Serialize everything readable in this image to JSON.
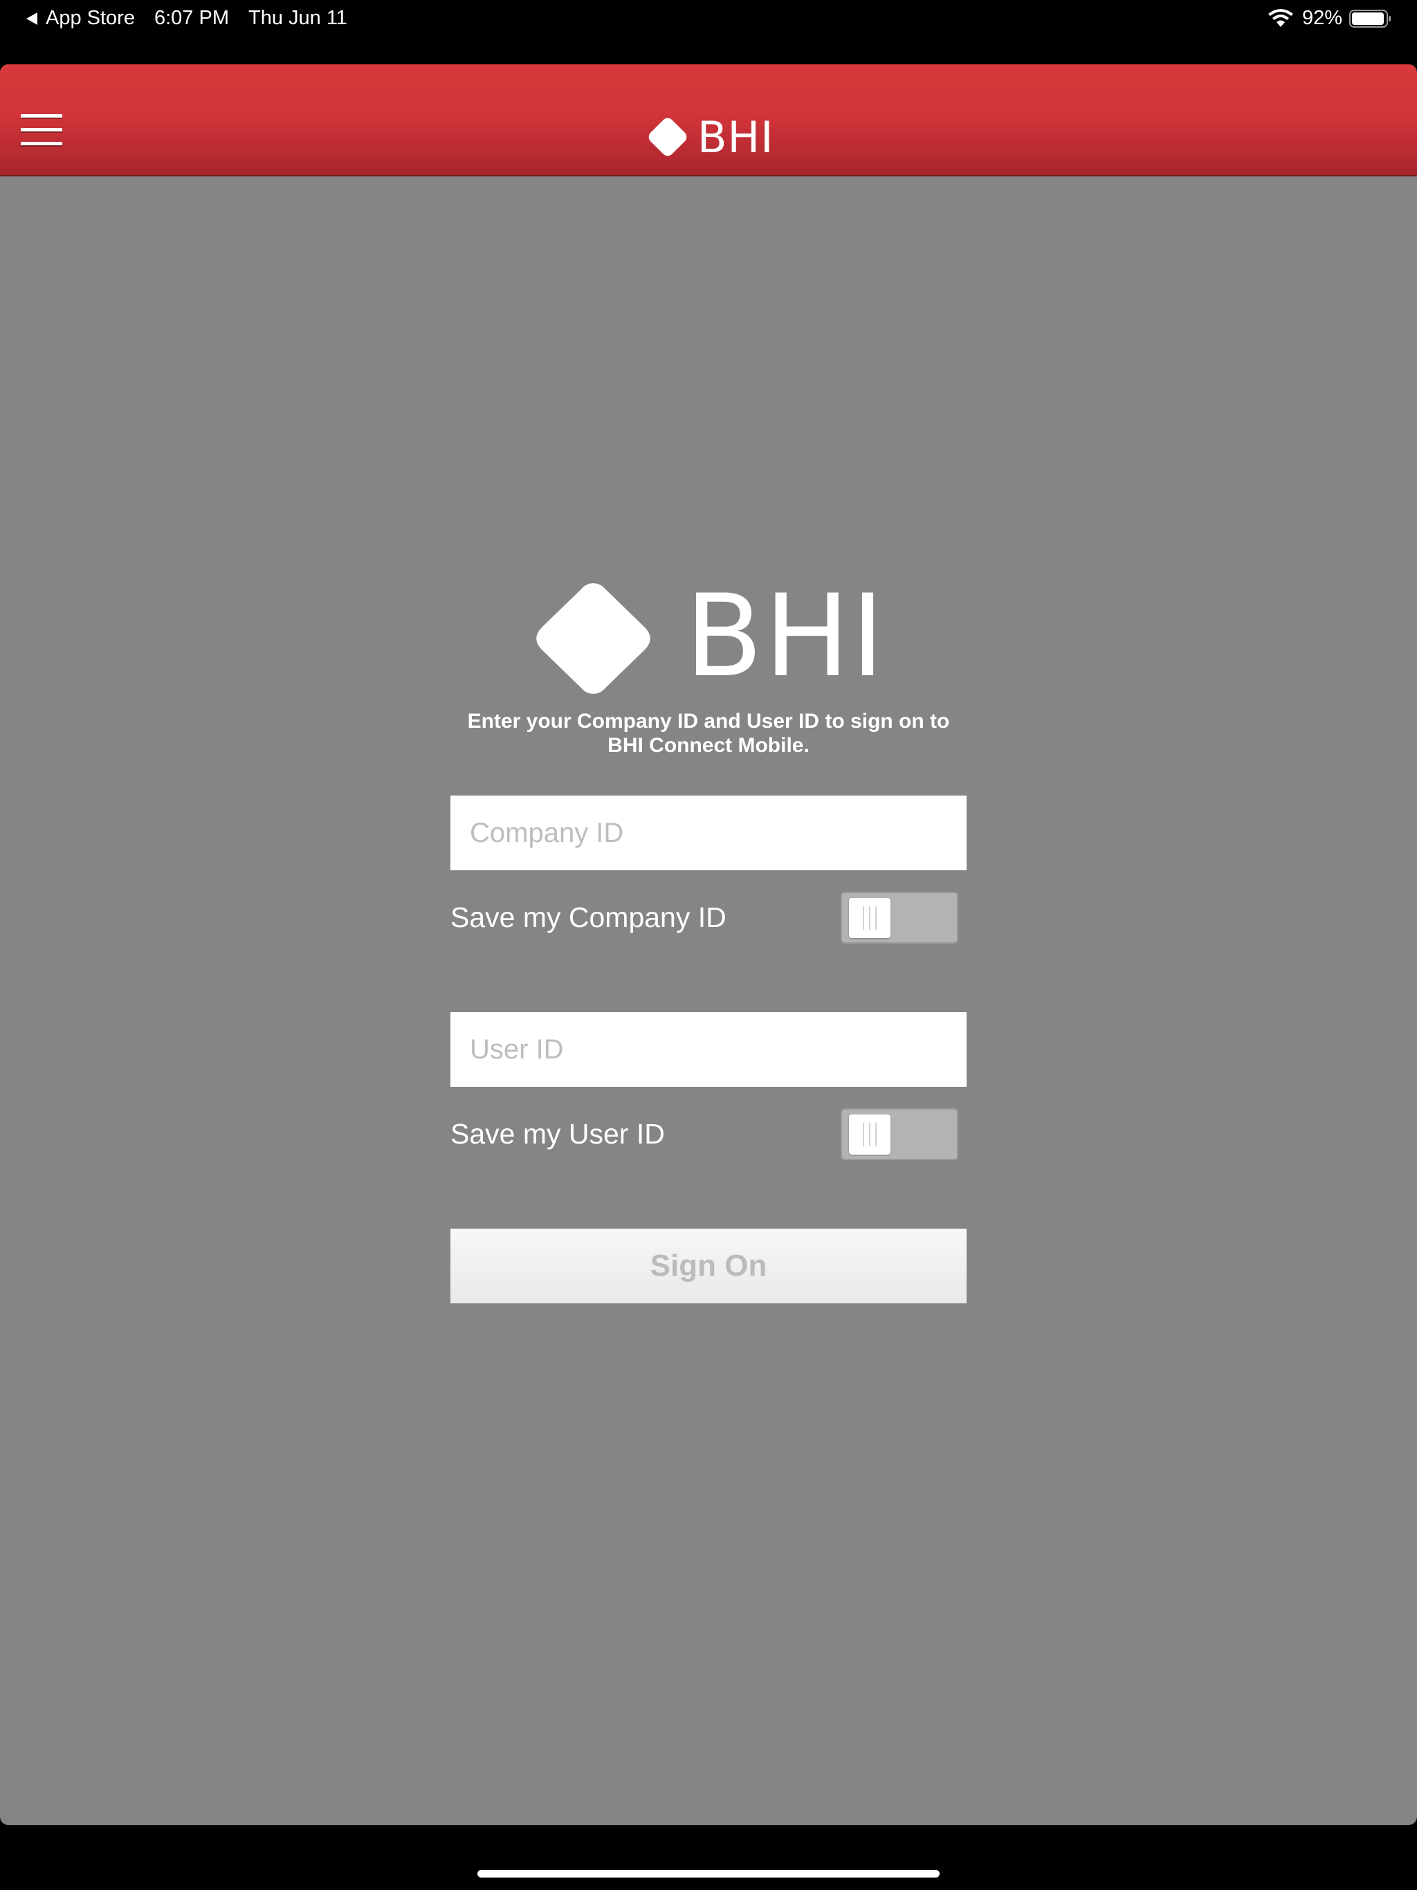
{
  "status_bar": {
    "back_app": "App Store",
    "time": "6:07 PM",
    "date": "Thu Jun 11",
    "battery": "92%",
    "icons": [
      "back-arrow-icon",
      "wifi-icon",
      "battery-icon"
    ]
  },
  "nav_bar": {
    "logo_text": "BHI",
    "icons": [
      "hamburger-menu-icon",
      "diamond-logo-icon"
    ]
  },
  "login": {
    "logo_text": "BHI",
    "instructions_line1": "Enter your Company ID and User ID to sign on to",
    "instructions_line2": "BHI Connect Mobile.",
    "company_id": {
      "placeholder": "Company ID",
      "value": "",
      "save_label": "Save my Company ID",
      "save_enabled": false
    },
    "user_id": {
      "placeholder": "User ID",
      "value": "",
      "save_label": "Save my User ID",
      "save_enabled": false
    },
    "sign_on_label": "Sign On"
  },
  "colors": {
    "header_red": "#d2343a",
    "background_gray": "#858585",
    "text_white": "#ffffff",
    "placeholder_gray": "#bdbdbd",
    "disabled_button_text": "#bbbbbb"
  }
}
